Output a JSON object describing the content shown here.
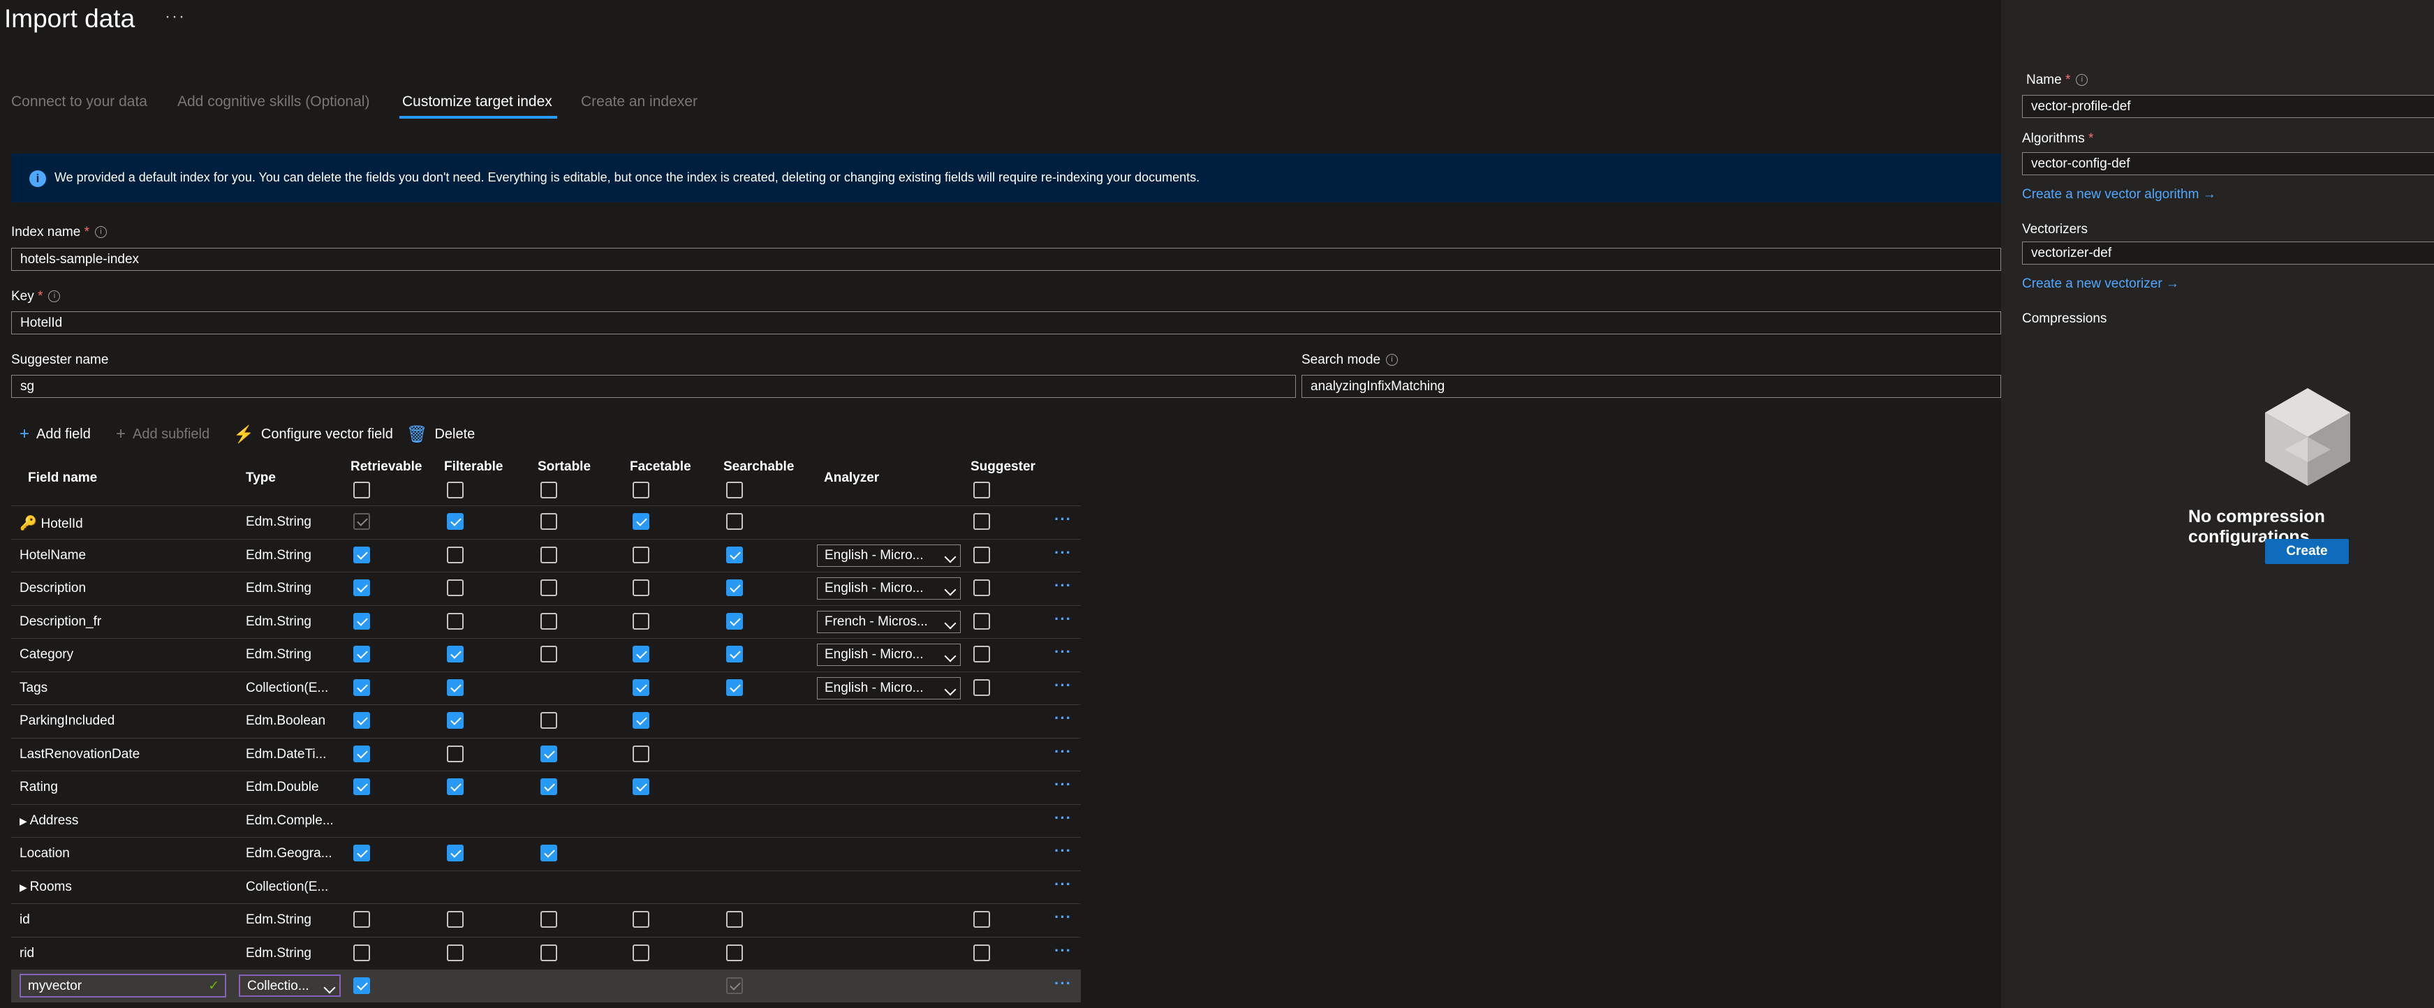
{
  "page": {
    "title": "Import data",
    "more": "···"
  },
  "wizard": {
    "tabs": [
      {
        "label": "Connect to your data"
      },
      {
        "label": "Add cognitive skills (Optional)"
      },
      {
        "label": "Customize target index"
      },
      {
        "label": "Create an indexer"
      }
    ]
  },
  "banner": {
    "text": "We provided a default index for you. You can delete the fields you don't need. Everything is editable, but once the index is created, deleting or changing existing fields will require re-indexing your documents."
  },
  "form": {
    "index_name": {
      "label": "Index name",
      "value": "hotels-sample-index"
    },
    "key": {
      "label": "Key",
      "value": "HotelId"
    },
    "suggester": {
      "label": "Suggester name",
      "value": "sg"
    },
    "search_mode": {
      "label": "Search mode",
      "value": "analyzingInfixMatching"
    }
  },
  "toolbar": {
    "add_field": "Add field",
    "add_subfield": "Add subfield",
    "configure_vector": "Configure vector field",
    "delete": "Delete"
  },
  "table": {
    "columns": [
      "Field name",
      "Type",
      "Retrievable",
      "Filterable",
      "Sortable",
      "Facetable",
      "Searchable",
      "Analyzer",
      "Suggester"
    ],
    "rows": [
      {
        "name": "HotelId",
        "type": "Edm.String",
        "retrievable": true,
        "filterable": true,
        "sortable": false,
        "facetable": true,
        "searchable": false,
        "analyzer": "",
        "suggester": false,
        "key": true
      },
      {
        "name": "HotelName",
        "type": "Edm.String",
        "retrievable": true,
        "filterable": false,
        "sortable": false,
        "facetable": false,
        "searchable": true,
        "analyzer": "English - Micro...",
        "suggester": false
      },
      {
        "name": "Description",
        "type": "Edm.String",
        "retrievable": true,
        "filterable": false,
        "sortable": false,
        "facetable": false,
        "searchable": true,
        "analyzer": "English - Micro...",
        "suggester": false
      },
      {
        "name": "Description_fr",
        "type": "Edm.String",
        "retrievable": true,
        "filterable": false,
        "sortable": false,
        "facetable": false,
        "searchable": true,
        "analyzer": "French - Micros...",
        "suggester": false
      },
      {
        "name": "Category",
        "type": "Edm.String",
        "retrievable": true,
        "filterable": true,
        "sortable": false,
        "facetable": true,
        "searchable": true,
        "analyzer": "English - Micro...",
        "suggester": false
      },
      {
        "name": "Tags",
        "type": "Collection(E...",
        "retrievable": true,
        "filterable": true,
        "sortable": null,
        "facetable": true,
        "searchable": true,
        "analyzer": "English - Micro...",
        "suggester": false
      },
      {
        "name": "ParkingIncluded",
        "type": "Edm.Boolean",
        "retrievable": true,
        "filterable": true,
        "sortable": false,
        "facetable": true,
        "searchable": null,
        "analyzer": "",
        "suggester": null
      },
      {
        "name": "LastRenovationDate",
        "type": "Edm.DateTi...",
        "retrievable": true,
        "filterable": false,
        "sortable": true,
        "facetable": false,
        "searchable": null,
        "analyzer": "",
        "suggester": null
      },
      {
        "name": "Rating",
        "type": "Edm.Double",
        "retrievable": true,
        "filterable": true,
        "sortable": true,
        "facetable": true,
        "searchable": null,
        "analyzer": "",
        "suggester": null
      },
      {
        "name": "Address",
        "type": "Edm.Comple...",
        "retrievable": null,
        "filterable": null,
        "sortable": null,
        "facetable": null,
        "searchable": null,
        "analyzer": "",
        "suggester": null,
        "expandable": true
      },
      {
        "name": "Location",
        "type": "Edm.Geogra...",
        "retrievable": true,
        "filterable": true,
        "sortable": true,
        "facetable": null,
        "searchable": null,
        "analyzer": "",
        "suggester": null
      },
      {
        "name": "Rooms",
        "type": "Collection(E...",
        "retrievable": null,
        "filterable": null,
        "sortable": null,
        "facetable": null,
        "searchable": null,
        "analyzer": "",
        "suggester": null,
        "expandable": true
      },
      {
        "name": "id",
        "type": "Edm.String",
        "retrievable": false,
        "filterable": false,
        "sortable": false,
        "facetable": false,
        "searchable": false,
        "analyzer": "",
        "suggester": false
      },
      {
        "name": "rid",
        "type": "Edm.String",
        "retrievable": false,
        "filterable": false,
        "sortable": false,
        "facetable": false,
        "searchable": false,
        "analyzer": "",
        "suggester": false
      },
      {
        "name": "myvector",
        "type": "Collectio...",
        "retrievable": true,
        "filterable": null,
        "sortable": null,
        "facetable": null,
        "searchable": true,
        "analyzer": "",
        "suggester": null,
        "editing": true
      }
    ]
  },
  "panel": {
    "name_label": "Name",
    "name_value": "vector-profile-def",
    "algorithms_label": "Algorithms",
    "algorithms_value": "vector-config-def",
    "create_algorithm_link": "Create a new vector algorithm →",
    "vectorizers_label": "Vectorizers",
    "vectorizers_value": "vectorizer-def",
    "create_vectorizer_link": "Create a new vectorizer →",
    "compressions_label": "Compressions",
    "empty_title": "No compression configurations",
    "create_button": "Create"
  },
  "colors": {
    "accent": "#2899f5",
    "link": "#4fa8ff",
    "banner_bg": "#001f3f",
    "required": "#ff6b6b"
  }
}
